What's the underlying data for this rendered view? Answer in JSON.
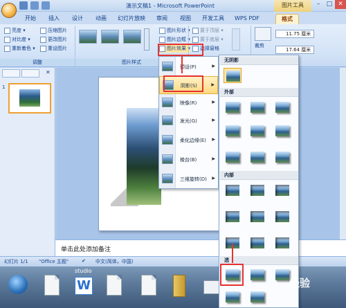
{
  "titlebar": {
    "title": "演示文稿1 - Microsoft PowerPoint",
    "context_tab": "图片工具",
    "minimize": "–",
    "maximize": "□",
    "close": "✕"
  },
  "tabs": [
    "开始",
    "插入",
    "设计",
    "动画",
    "幻灯片放映",
    "审阅",
    "视图",
    "开发工具",
    "WPS PDF",
    "格式"
  ],
  "active_tab": "格式",
  "ribbon": {
    "adjust": {
      "brightness": "亮度 ▾",
      "contrast": "对比度 ▾",
      "recolor": "重新着色 ▾",
      "compress": "压缩图片",
      "change_picture": "更改图片",
      "reset_picture": "重设图片",
      "group_label": "调整"
    },
    "picture_styles": {
      "shape": "图片形状 ▾",
      "border": "图片边框 ▾",
      "effects": "图片效果 ▾",
      "group_label": "图片样式"
    },
    "arrange": {
      "bring_front": "置于顶层 ▾",
      "send_back": "置于底层 ▾",
      "selection_pane": "选择窗格"
    },
    "size": {
      "crop": "裁剪",
      "height": "11.75 厘米",
      "width": "17.64 厘米"
    }
  },
  "menu": {
    "items": [
      {
        "label": "预设(P)"
      },
      {
        "label": "阴影(S)"
      },
      {
        "label": "映像(R)"
      },
      {
        "label": "发光(G)"
      },
      {
        "label": "柔化边缘(E)"
      },
      {
        "label": "棱台(B)"
      },
      {
        "label": "三维旋转(D)"
      }
    ],
    "highlighted": "阴影(S)"
  },
  "gallery": {
    "sections": [
      "无阴影",
      "外部",
      "内部",
      "透"
    ]
  },
  "notes_placeholder": "单击此处添加备注",
  "status": {
    "slide": "幻灯片 1/1",
    "theme": "\"Office 主题\"",
    "language": "中文(简体，中国)"
  },
  "taskbar": {
    "studio_label": "studio"
  },
  "watermark": "经验"
}
